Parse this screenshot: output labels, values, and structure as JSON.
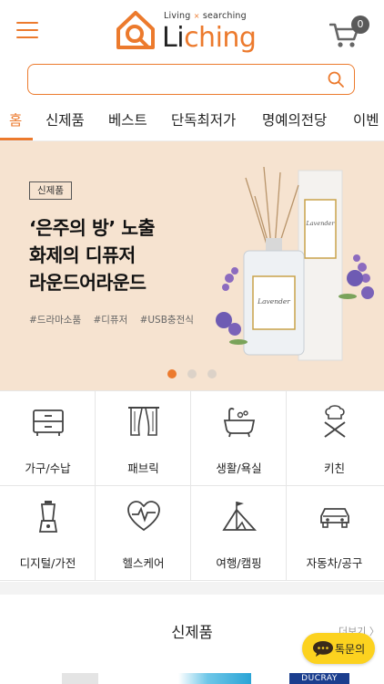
{
  "header": {
    "menu_icon": "hamburger-icon",
    "logo_tag_left": "Living",
    "logo_tag_sep": "×",
    "logo_tag_right": "searching",
    "logo_text_main": "Li",
    "logo_text_accent": "ching",
    "cart_icon": "cart-icon",
    "cart_count": "0"
  },
  "search": {
    "value": "",
    "placeholder": "",
    "icon": "search-icon"
  },
  "tabs": [
    {
      "label": "홈",
      "active": true
    },
    {
      "label": "신제품"
    },
    {
      "label": "베스트"
    },
    {
      "label": "단독최저가"
    },
    {
      "label": "명예의전당"
    },
    {
      "label": "이벤"
    }
  ],
  "banner": {
    "badge": "신제품",
    "title_lines": [
      "‘은주의 방’ 노출",
      "화제의 디퓨저",
      "라운드어라운드"
    ],
    "tags": [
      "#드라마소품",
      "#디퓨저",
      "#USB충전식"
    ],
    "product_label": "Lavender",
    "slides_total": 3,
    "active_slide": 1
  },
  "categories": [
    {
      "label": "가구/수납",
      "icon": "cabinet-icon"
    },
    {
      "label": "패브릭",
      "icon": "curtain-icon"
    },
    {
      "label": "생활/욕실",
      "icon": "bathtub-icon"
    },
    {
      "label": "키친",
      "icon": "chef-utensils-icon"
    },
    {
      "label": "디지털/가전",
      "icon": "blender-icon"
    },
    {
      "label": "헬스케어",
      "icon": "heartbeat-icon"
    },
    {
      "label": "여행/캠핑",
      "icon": "tent-icon"
    },
    {
      "label": "자동차/공구",
      "icon": "car-icon"
    }
  ],
  "new_products": {
    "title": "신제품",
    "more_label": "더보기 〉",
    "thumb_brand": "DUCRAY"
  },
  "chat": {
    "label": "톡문의",
    "icon": "chat-bubble-icon"
  },
  "colors": {
    "accent": "#ec7a2d",
    "banner_bg": "#f6e3d0",
    "chat_bg": "#fcd21f"
  }
}
